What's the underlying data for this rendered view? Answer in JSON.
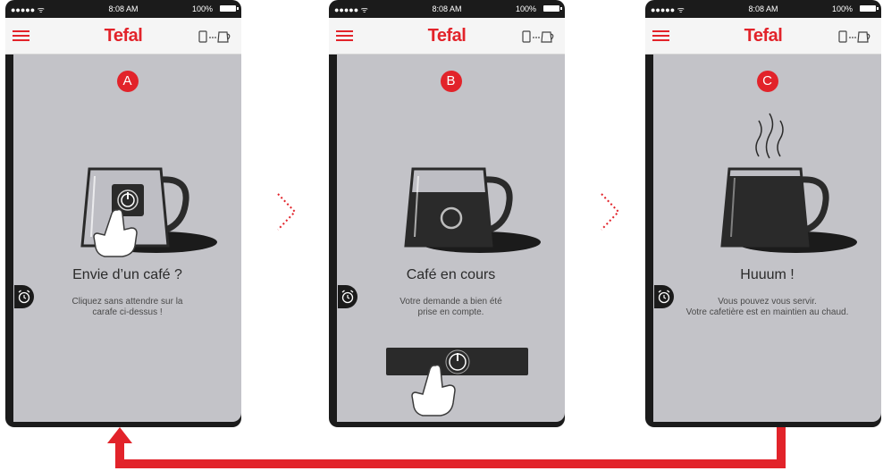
{
  "status_bar": {
    "signal": "●●●●● ᯤ",
    "time": "8:08 AM",
    "battery": "100%"
  },
  "header": {
    "brand": "Tefal"
  },
  "screens": [
    {
      "step": "A",
      "title": "Envie d’un café ?",
      "description": "Cliquez sans attendre sur la\ncarafe ci-dessus !"
    },
    {
      "step": "B",
      "title": "Café en cours",
      "description": "Votre demande a bien été\nprise en compte."
    },
    {
      "step": "C",
      "title": "Huuum !",
      "description": "Vous pouvez vous servir.\nVotre cafetière est en maintien au chaud."
    }
  ],
  "colors": {
    "accent": "#e2232a",
    "screen_bg": "#c3c3c8",
    "phone_frame": "#1b1b1b",
    "coffee": "#2a2a2a"
  },
  "icons": {
    "menu": "hamburger-menu-icon",
    "device": "phone-to-kettle-connection-icon",
    "timer": "alarm-clock-icon",
    "power": "power-icon",
    "hand": "tapping-hand-icon",
    "progress": "progress-ring-icon",
    "steam": "steam-icon",
    "next": "chevron-right-dotted-icon",
    "loop": "loop-back-arrow"
  }
}
